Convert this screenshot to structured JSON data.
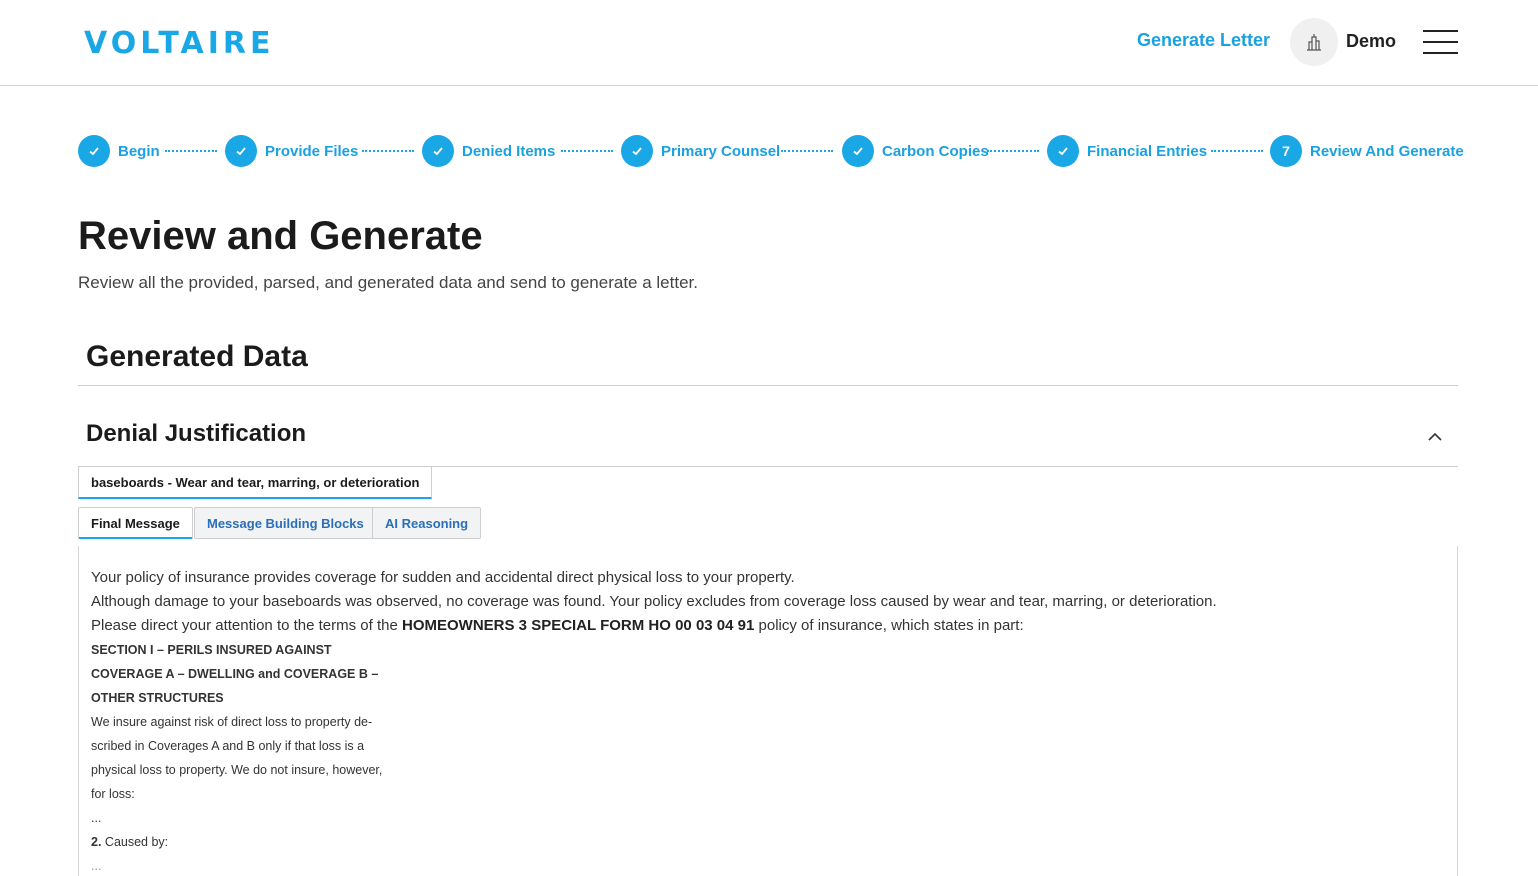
{
  "header": {
    "logo": "VOLTAIRE",
    "generate_letter": "Generate Letter",
    "user_name": "Demo"
  },
  "steps": [
    {
      "label": "Begin",
      "done": true
    },
    {
      "label": "Provide Files",
      "done": true
    },
    {
      "label": "Denied Items",
      "done": true
    },
    {
      "label": "Primary Counsel",
      "done": true
    },
    {
      "label": "Carbon Copies",
      "done": true
    },
    {
      "label": "Financial Entries",
      "done": true
    },
    {
      "label": "Review And Generate",
      "done": false,
      "number": "7"
    }
  ],
  "page": {
    "title": "Review and Generate",
    "subtitle": "Review all the provided, parsed, and generated data and send to generate a letter."
  },
  "generated_data": {
    "title": "Generated Data"
  },
  "denial": {
    "title": "Denial Justification",
    "item_tab": "baseboards - Wear and tear, marring, or deterioration",
    "tabs": [
      "Final Message",
      "Message Building Blocks",
      "AI Reasoning"
    ],
    "active_tab": "Final Message",
    "message": {
      "line1": "Your policy of insurance provides coverage for sudden and accidental direct physical loss to your property.",
      "line2": "Although damage to your baseboards was observed, no coverage was found. Your policy excludes from coverage loss caused by wear and tear, marring, or deterioration.",
      "line3_pre": "Please direct your attention to the terms of the ",
      "line3_bold": "HOMEOWNERS 3 SPECIAL FORM HO 00 03 04 91",
      "line3_post": " policy of insurance, which states in part:",
      "section_head": "SECTION I – PERILS INSURED AGAINST",
      "coverage_a": "COVERAGE A – DWELLING and COVERAGE B –",
      "other_structures": "OTHER STRUCTURES",
      "body1": "We insure against risk of direct loss to property de-",
      "body2": "scribed in Coverages A and B only if that loss is a",
      "body3": "physical loss to property. We do not insure, however,",
      "body4": "for loss:",
      "ellipsis": "...",
      "item_num": "2.",
      "item_text": " Caused by:",
      "trailing": "..."
    }
  },
  "colors": {
    "accent": "#1aa7e6",
    "link": "#1aa1e0",
    "tab_inactive_text": "#2a6fb8"
  }
}
